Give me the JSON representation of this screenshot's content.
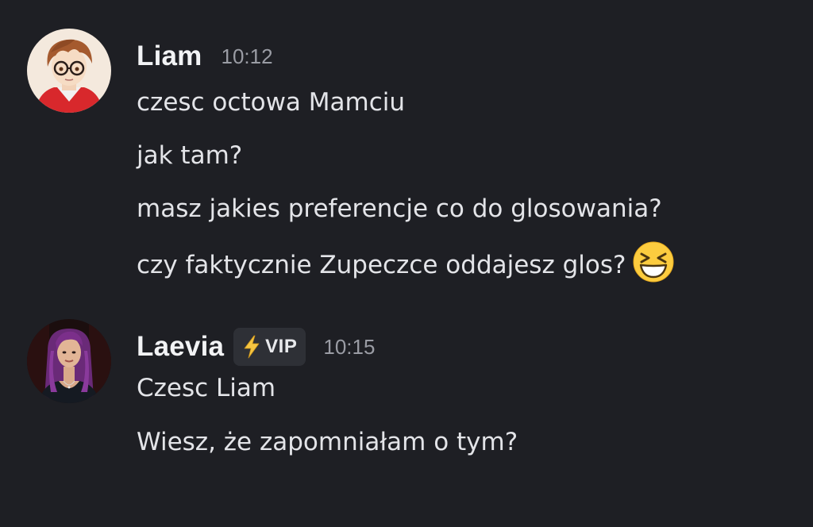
{
  "messages": [
    {
      "author": "Liam",
      "time": "10:12",
      "avatar_icon": "anime-boy-glasses-avatar",
      "lines": [
        "czesc octowa Mamciu",
        "jak tam?",
        "masz jakies preferencje co do glosowania?",
        "czy faktycznie Zupeczce oddajesz glos?"
      ],
      "trailing_emoji": "laughing-squint-emoji"
    },
    {
      "author": "Laevia",
      "badge": {
        "icon": "lightning-icon",
        "label": "VIP"
      },
      "time": "10:15",
      "avatar_icon": "woman-purple-hair-avatar",
      "lines": [
        "Czesc Liam",
        "Wiesz, że zapomniałam o tym?"
      ]
    }
  ],
  "colors": {
    "background": "#1e1f24",
    "text": "#e3e4e8",
    "username": "#f2f3f5",
    "timestamp": "#9a9ca4",
    "badge_bg": "#2e3036"
  }
}
